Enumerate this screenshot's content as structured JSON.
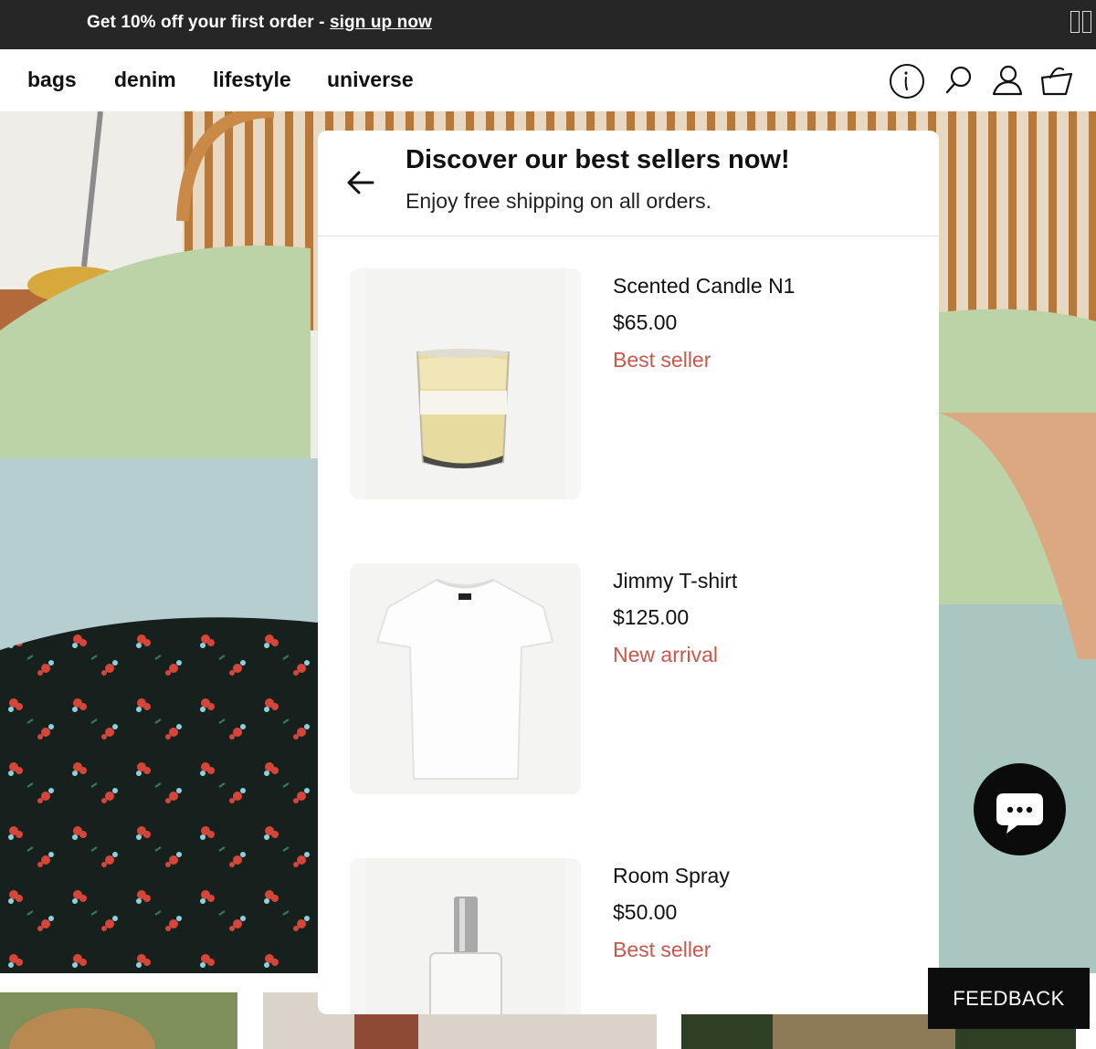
{
  "promo": {
    "text": "Get 10% off your first order - ",
    "link": "sign up now"
  },
  "nav": {
    "items": [
      "bags",
      "denim",
      "lifestyle",
      "universe"
    ],
    "icons": [
      "info-icon",
      "search-icon",
      "account-icon",
      "cart-icon"
    ]
  },
  "modal": {
    "title": "Discover our best sellers now!",
    "subtitle": "Enjoy free shipping on all orders.",
    "products": [
      {
        "name": "Scented Candle N1",
        "price": "$65.00",
        "badge": "Best seller",
        "image": "candle"
      },
      {
        "name": "Jimmy T-shirt",
        "price": "$125.00",
        "badge": "New arrival",
        "image": "tshirt"
      },
      {
        "name": "Room Spray",
        "price": "$50.00",
        "badge": "Best seller",
        "image": "spray"
      }
    ]
  },
  "feedback": {
    "label": "FEEDBACK"
  },
  "colors": {
    "promo_bg": "#262626",
    "badge": "#c9574c",
    "chat_bg": "#0b0b0b"
  }
}
